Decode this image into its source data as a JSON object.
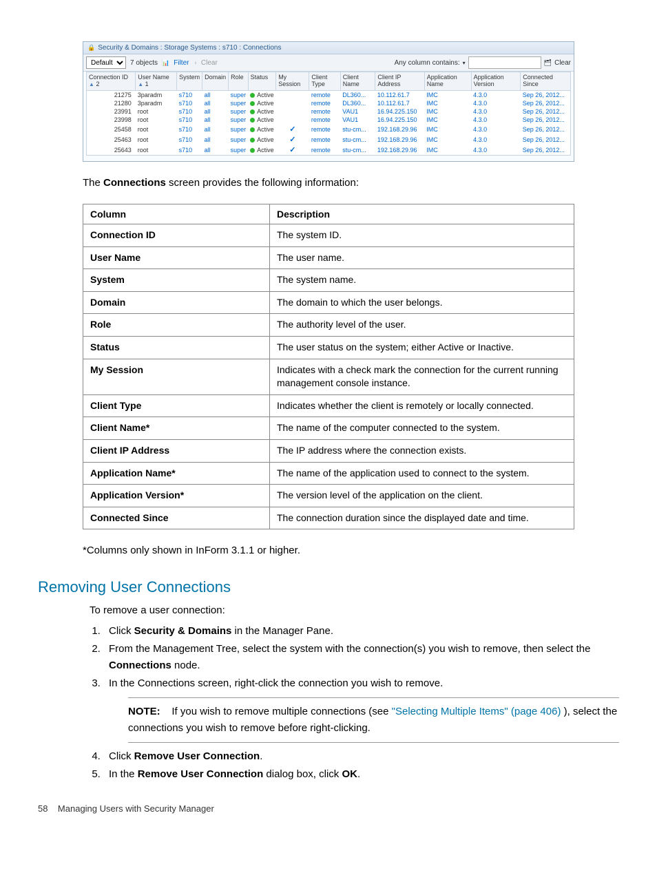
{
  "screenshot": {
    "breadcrumb": "Security & Domains : Storage Systems : s710 : Connections",
    "toolbar": {
      "category": "Default",
      "objects": "7 objects",
      "filter": "Filter",
      "clear": "Clear",
      "anycol": "Any column contains:",
      "clear_right": "Clear"
    },
    "headers": [
      "Connection ID",
      "User Name",
      "System",
      "Domain",
      "Role",
      "Status",
      "My Session",
      "Client Type",
      "Client Name",
      "Client IP Address",
      "Application Name",
      "Application Version",
      "Connected Since"
    ],
    "sort1": "2",
    "sort2": "1",
    "rows": [
      {
        "id": "21275",
        "user": "3paradm",
        "sys": "s710",
        "dom": "all",
        "role": "super",
        "status": "Active",
        "my": "",
        "ctype": "remote",
        "cname": "DL360...",
        "cip": "10.112.61.7",
        "app": "IMC",
        "ver": "4.3.0",
        "since": "Sep 26, 2012..."
      },
      {
        "id": "21280",
        "user": "3paradm",
        "sys": "s710",
        "dom": "all",
        "role": "super",
        "status": "Active",
        "my": "",
        "ctype": "remote",
        "cname": "DL360...",
        "cip": "10.112.61.7",
        "app": "IMC",
        "ver": "4.3.0",
        "since": "Sep 26, 2012..."
      },
      {
        "id": "23991",
        "user": "root",
        "sys": "s710",
        "dom": "all",
        "role": "super",
        "status": "Active",
        "my": "",
        "ctype": "remote",
        "cname": "VAU1",
        "cip": "16.94.225.150",
        "app": "IMC",
        "ver": "4.3.0",
        "since": "Sep 26, 2012..."
      },
      {
        "id": "23998",
        "user": "root",
        "sys": "s710",
        "dom": "all",
        "role": "super",
        "status": "Active",
        "my": "",
        "ctype": "remote",
        "cname": "VAU1",
        "cip": "16.94.225.150",
        "app": "IMC",
        "ver": "4.3.0",
        "since": "Sep 26, 2012..."
      },
      {
        "id": "25458",
        "user": "root",
        "sys": "s710",
        "dom": "all",
        "role": "super",
        "status": "Active",
        "my": "✓",
        "ctype": "remote",
        "cname": "stu-cm...",
        "cip": "192.168.29.96",
        "app": "IMC",
        "ver": "4.3.0",
        "since": "Sep 26, 2012..."
      },
      {
        "id": "25463",
        "user": "root",
        "sys": "s710",
        "dom": "all",
        "role": "super",
        "status": "Active",
        "my": "✓",
        "ctype": "remote",
        "cname": "stu-cm...",
        "cip": "192.168.29.96",
        "app": "IMC",
        "ver": "4.3.0",
        "since": "Sep 26, 2012..."
      },
      {
        "id": "25643",
        "user": "root",
        "sys": "s710",
        "dom": "all",
        "role": "super",
        "status": "Active",
        "my": "✓",
        "ctype": "remote",
        "cname": "stu-cm...",
        "cip": "192.168.29.96",
        "app": "IMC",
        "ver": "4.3.0",
        "since": "Sep 26, 2012..."
      }
    ]
  },
  "intro_pre": "The ",
  "intro_bold": "Connections",
  "intro_post": " screen provides the following information:",
  "desc_table": {
    "head_col": "Column",
    "head_desc": "Description",
    "rows": [
      {
        "c": "Connection ID",
        "d": "The system ID."
      },
      {
        "c": "User Name",
        "d": "The user name."
      },
      {
        "c": "System",
        "d": "The system name."
      },
      {
        "c": "Domain",
        "d": "The domain to which the user belongs."
      },
      {
        "c": "Role",
        "d": "The authority level of the user."
      },
      {
        "c": "Status",
        "d": "The user status on the system; either Active or Inactive."
      },
      {
        "c": "My Session",
        "d": "Indicates with a check mark the connection for the current running management console instance."
      },
      {
        "c": "Client Type",
        "d": "Indicates whether the client is remotely or locally connected."
      },
      {
        "c": "Client Name*",
        "d": "The name of the computer connected to the system."
      },
      {
        "c": "Client IP Address",
        "d": "The IP address where the connection exists."
      },
      {
        "c": "Application Name*",
        "d": "The name of the application used to connect to the system."
      },
      {
        "c": "Application Version*",
        "d": "The version level of the application on the client."
      },
      {
        "c": "Connected Since",
        "d": "The connection duration since the displayed date and time."
      }
    ]
  },
  "footnote": "*Columns only shown in InForm 3.1.1 or higher.",
  "heading": "Removing User Connections",
  "intro2": "To remove a user connection:",
  "step1_pre": "Click ",
  "step1_b": "Security & Domains",
  "step1_post": " in the Manager Pane.",
  "step2_pre": "From the Management Tree, select the system with the connection(s) you wish to remove, then select the ",
  "step2_b": "Connections",
  "step2_post": " node.",
  "step3": "In the Connections screen, right-click the connection you wish to remove.",
  "note_label": "NOTE:",
  "note_pre": "If you wish to remove multiple connections (see ",
  "note_link": "\"Selecting Multiple Items\" (page 406)",
  "note_post": " ), select the connections you wish to remove before right-clicking.",
  "step4_pre": "Click ",
  "step4_b": "Remove User Connection",
  "step4_post": ".",
  "step5_pre": "In the ",
  "step5_b": "Remove User Connection",
  "step5_mid": " dialog box, click ",
  "step5_b2": "OK",
  "step5_post": ".",
  "page_num": "58",
  "footer_text": "Managing Users with Security Manager"
}
